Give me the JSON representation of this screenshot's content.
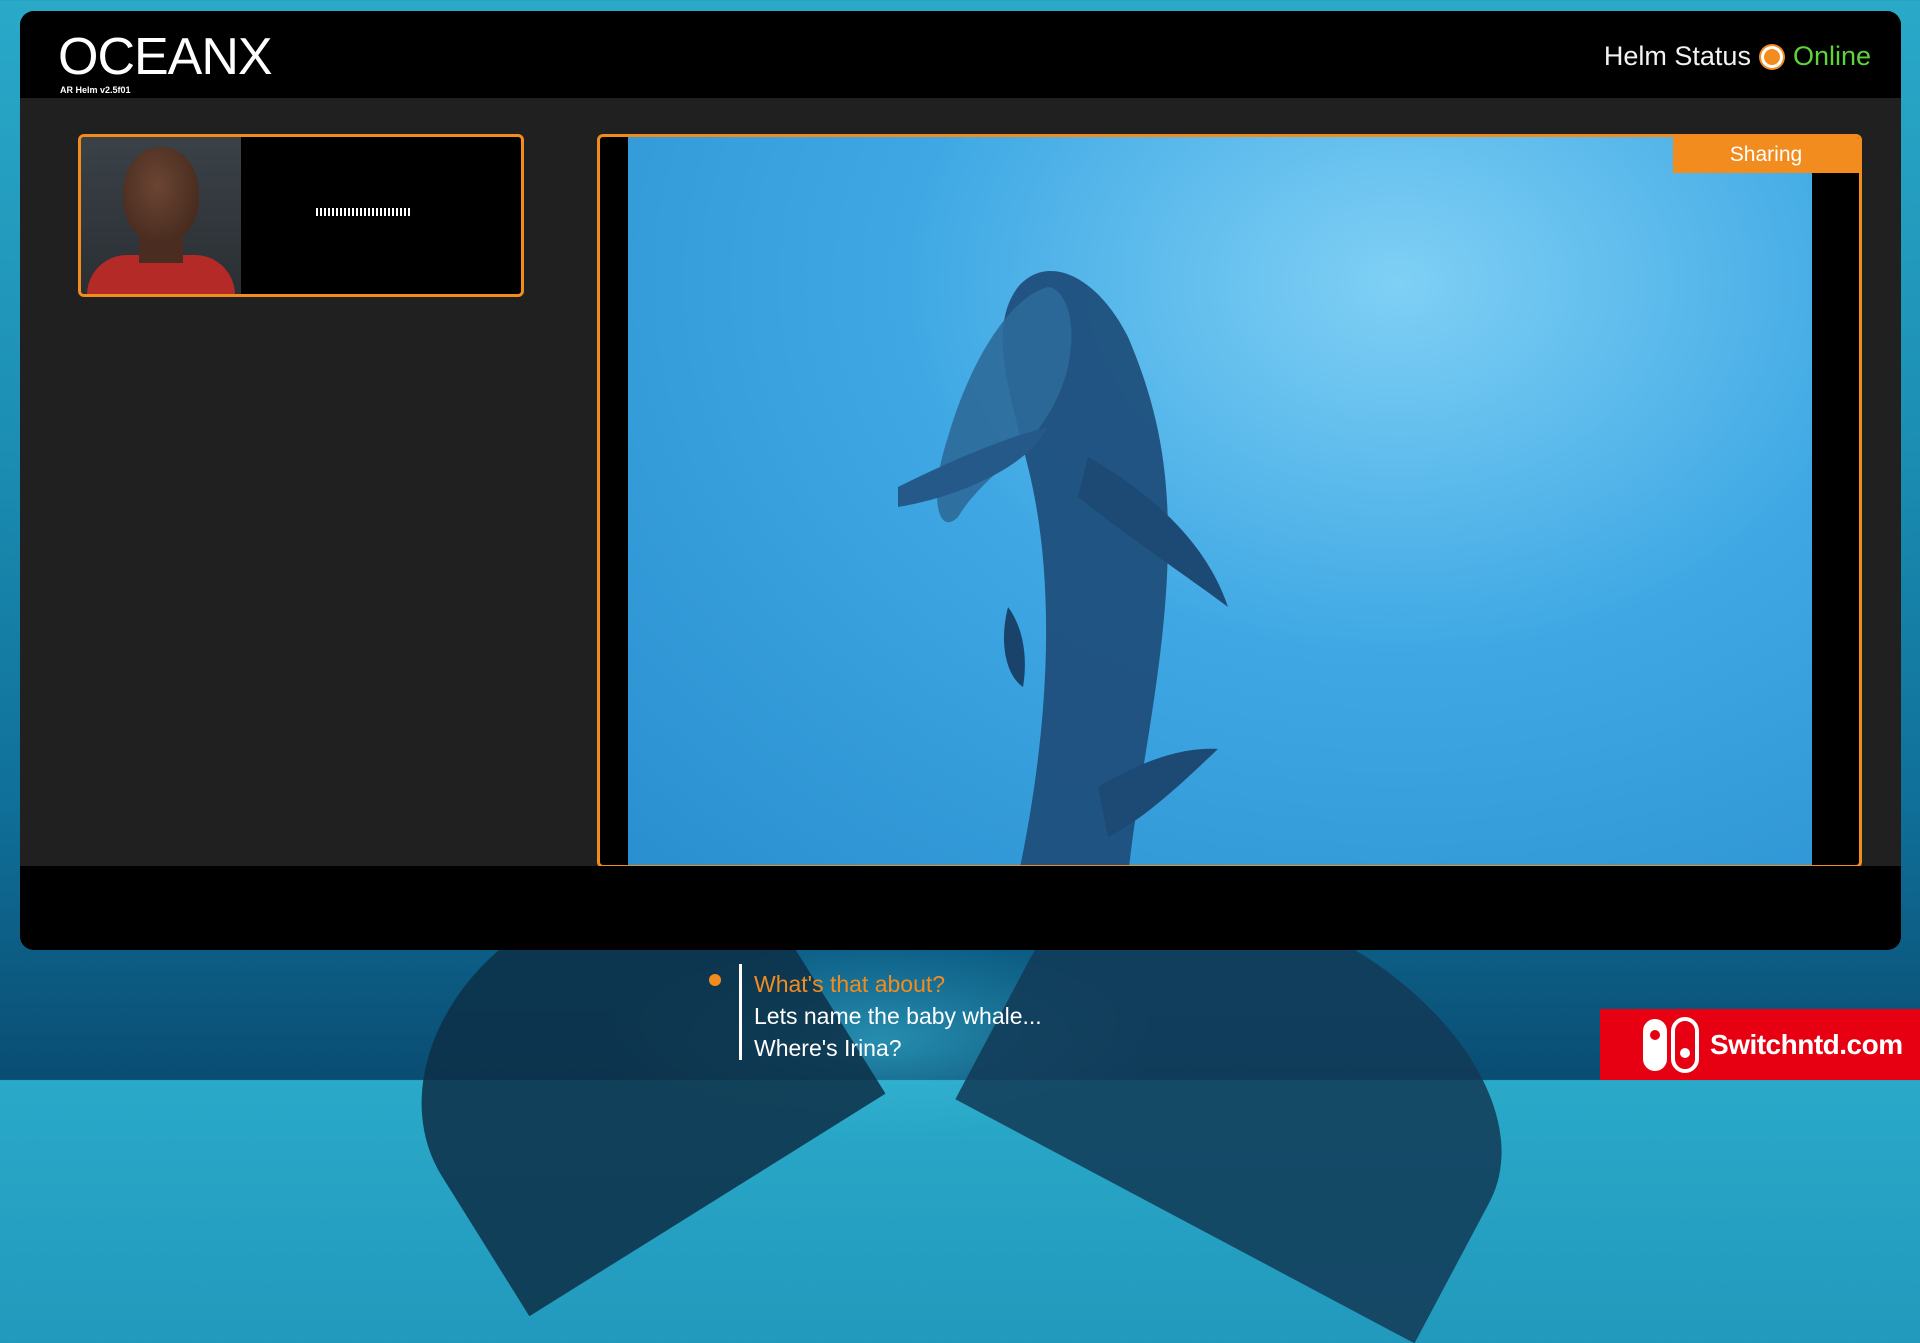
{
  "app": {
    "logo": "OCEANX",
    "version": "AR Helm v2.5f01"
  },
  "header": {
    "status_label": "Helm Status",
    "status_value": "Online",
    "status_color": "#5fd43a",
    "indicator_color": "#f28c1e"
  },
  "contact": {
    "avatar_icon": "person-avatar-icon",
    "audio_icon": "audio-waveform-icon"
  },
  "share": {
    "badge": "Sharing"
  },
  "dialogue": {
    "options": [
      {
        "label": "What's that about?",
        "selected": true
      },
      {
        "label": "Lets name the baby whale...",
        "selected": false
      },
      {
        "label": "Where's Irina?",
        "selected": false
      }
    ]
  },
  "watermark": {
    "text": "Switchntd.com",
    "icon": "nintendo-switch-logo-icon"
  },
  "colors": {
    "accent": "#f28c1e",
    "panel": "#202020",
    "frame": "#000000",
    "watermark_bg": "#e60012"
  }
}
